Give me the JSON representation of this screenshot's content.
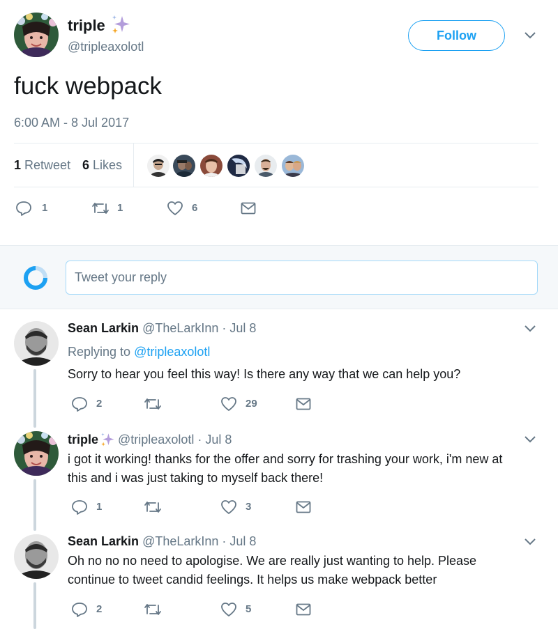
{
  "tweet": {
    "display_name": "triple",
    "handle": "@tripleaxolotl",
    "follow_label": "Follow",
    "text": "fuck webpack",
    "timestamp": "6:00 AM - 8 Jul 2017",
    "retweet_count": "1",
    "retweet_label": "Retweet",
    "like_count": "6",
    "like_label": "Likes",
    "actions": {
      "replies": "1",
      "retweets": "1",
      "likes": "6"
    },
    "sparkle_colors": [
      "#b39ddb",
      "#f5a623"
    ]
  },
  "reply_box": {
    "placeholder": "Tweet your reply"
  },
  "replies": [
    {
      "display_name": "Sean Larkin",
      "handle": "@TheLarkInn",
      "separator": "·",
      "date": "Jul 8",
      "replying_prefix": "Replying to",
      "replying_to": "@tripleaxolotl",
      "text": "Sorry to hear you feel this way! Is there any way that we can help you?",
      "actions": {
        "replies": "2",
        "retweets": "",
        "likes": "29"
      }
    },
    {
      "display_name": "triple",
      "handle": "@tripleaxolotl",
      "separator": "·",
      "date": "Jul 8",
      "text_line1": "i got it working! thanks for the offer and sorry for trashing your work, i'm new at",
      "text_line2": "this and i was just taking to myself back there!",
      "actions": {
        "replies": "1",
        "retweets": "",
        "likes": "3"
      }
    },
    {
      "display_name": "Sean Larkin",
      "handle": "@TheLarkInn",
      "separator": "·",
      "date": "Jul 8",
      "text_line1": "Oh no no no need to apologise. We are really just wanting to help. Please",
      "text_line2": "continue to tweet candid feelings. It helps us make webpack better",
      "actions": {
        "replies": "2",
        "retweets": "",
        "likes": "5"
      }
    }
  ],
  "colors": {
    "accent": "#1da1f2",
    "secondary_text": "#657786",
    "border": "#e6ecf0",
    "reply_band": "#f5f8fa",
    "thread_line": "#ccd6dd"
  }
}
